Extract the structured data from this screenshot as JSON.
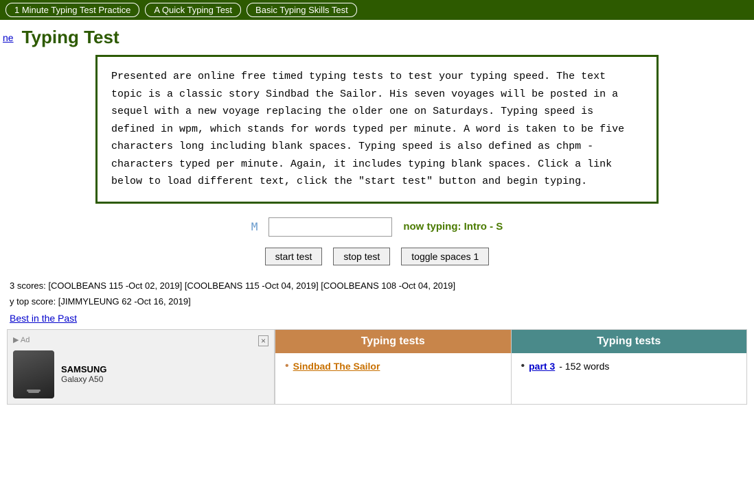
{
  "topNav": {
    "links": [
      {
        "label": "1 Minute Typing Test Practice",
        "id": "nav-1min"
      },
      {
        "label": "A Quick Typing Test",
        "id": "nav-quick"
      },
      {
        "label": "Basic Typing Skills Test",
        "id": "nav-basic"
      }
    ]
  },
  "header": {
    "backLinkLabel": "ne",
    "title": "Typing Test"
  },
  "description": {
    "text": "Presented are online free timed typing tests to test your typing speed. The text topic is a classic story Sindbad the Sailor. His seven voyages will be posted in a sequel with a new voyage replacing the older one on Saturdays. Typing speed is defined in wpm, which stands for words typed per minute. A word is taken to be five characters long including blank spaces. Typing speed is also defined as chpm - characters typed per minute. Again, it includes typing blank spaces. Click a link below to load different text, click the \"start test\" button and begin typing."
  },
  "typingArea": {
    "cursorLabel": "M",
    "nowTypingLabel": "now typing: Intro - S"
  },
  "buttons": {
    "startTest": "start test",
    "stopTest": "stop test",
    "toggleSpaces": "toggle spaces 1"
  },
  "scores": {
    "line1": "3 scores: [COOLBEANS 115 -Oct 02, 2019] [COOLBEANS 115 -Oct 04, 2019] [COOLBEANS 108 -Oct 04, 2019]",
    "line2": "y top score: [JIMMYLEUNG 62 -Oct 16, 2019]",
    "bestLinkLabel": "Best in the Past"
  },
  "ad": {
    "brand": "SAMSUNG",
    "model": "Galaxy A50",
    "closeLabel": "×",
    "adLabel": "Ad"
  },
  "panel1": {
    "header": "Typing tests",
    "item1": "Sindbad The Sailor"
  },
  "panel2": {
    "header": "Typing tests",
    "item1Link": "part 3",
    "item1Text": "- 152 words"
  }
}
